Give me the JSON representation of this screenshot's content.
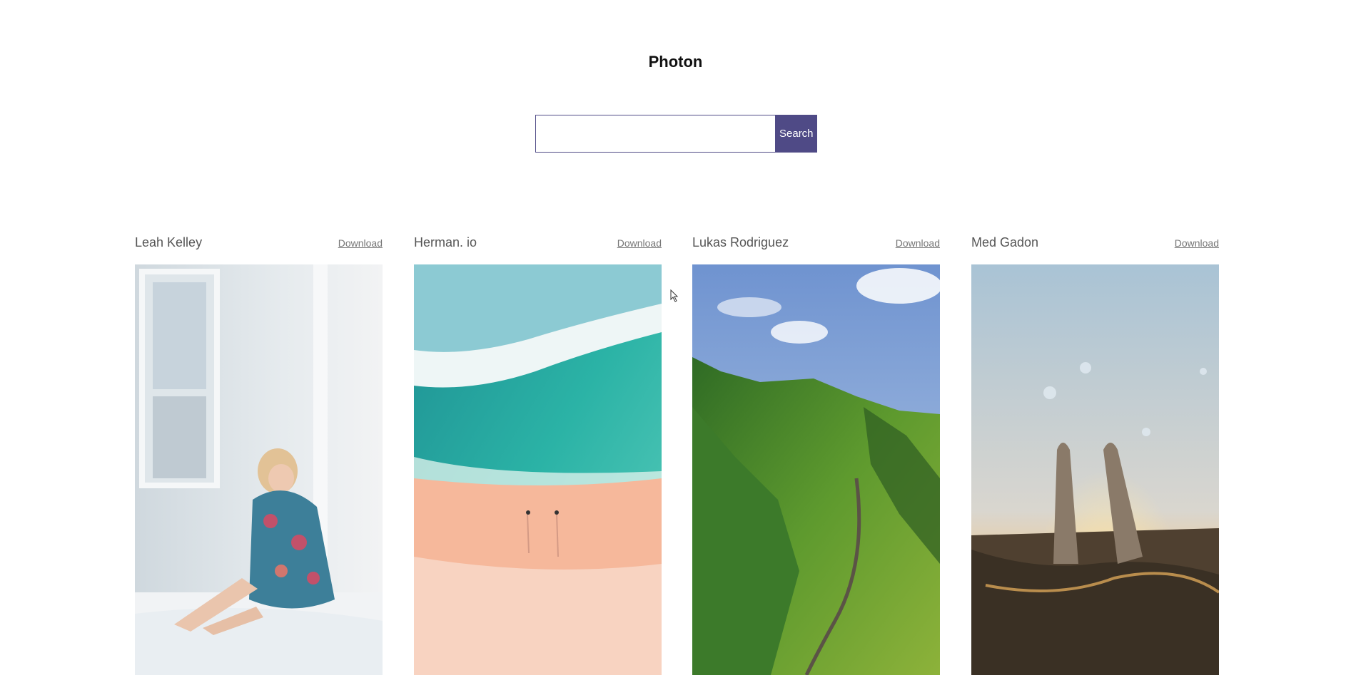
{
  "app": {
    "title": "Photon"
  },
  "search": {
    "placeholder": "",
    "value": "",
    "button_label": "Search"
  },
  "photos": [
    {
      "photographer": "Leah Kelley",
      "download_label": "Download",
      "image": "woman-in-floral-dress-sitting-on-bed"
    },
    {
      "photographer": "Herman. io",
      "download_label": "Download",
      "image": "aerial-beach-waves"
    },
    {
      "photographer": "Lukas Rodriguez",
      "download_label": "Download",
      "image": "green-mountain-valley-road"
    },
    {
      "photographer": "Med Gadon",
      "download_label": "Download",
      "image": "feet-in-water-at-sunset"
    }
  ],
  "colors": {
    "accent": "#4f4a86",
    "background": "#ffffff"
  }
}
